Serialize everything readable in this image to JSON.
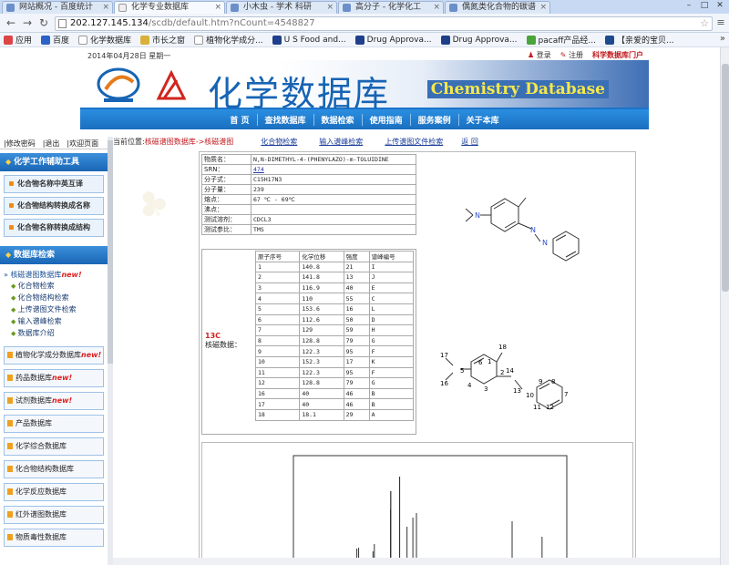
{
  "browser": {
    "tabs": [
      {
        "label": "网站概况 - 百度统计",
        "active": false
      },
      {
        "label": "化学专业数据库",
        "active": true
      },
      {
        "label": "小木虫 - 学术 科研",
        "active": false
      },
      {
        "label": "高分子 - 化学化工",
        "active": false
      },
      {
        "label": "偶氮类化合物的碳谱",
        "active": false
      }
    ],
    "url_host": "202.127.145.134",
    "url_path": "/scdb/default.htm?nCount=4548827",
    "bookmarks": [
      "应用",
      "百度",
      "化学数据库",
      "市长之窗",
      "植物化学成分...",
      "U S Food and...",
      "Drug Approva...",
      "Drug Approva...",
      "pacaff产品经...",
      "【亲爱的宝贝..."
    ],
    "bookmarks_more": "»"
  },
  "header": {
    "date": "2014年04月28日 星期一",
    "login": "登录",
    "register": "注册",
    "portal": "科学数据库门户",
    "title": "化学数据库",
    "title_en": "Chemistry Database",
    "nav": [
      "首 页",
      "查找数据库",
      "数据检索",
      "使用指南",
      "服务案例",
      "关于本库"
    ]
  },
  "sidebar": {
    "top_links": [
      "|修改密码",
      "|退出",
      "|欢迎页面"
    ],
    "tools_head": "化学工作辅助工具",
    "tools": [
      "化合物名称中英互译",
      "化合物结构转换成名称",
      "化合物名称转换成结构"
    ],
    "search_head": "数据库检索",
    "nmr_db": "核磁谱图数据库",
    "nmr_new": "new!",
    "nmr_items": [
      "化合物检索",
      "化合物结构检索",
      "上传谱图文件检索",
      "输入谱峰检索",
      "数据库介绍"
    ],
    "dbs": [
      {
        "label": "植物化学成分数据库",
        "new": "new!"
      },
      {
        "label": "药品数据库",
        "new": "new!"
      },
      {
        "label": "试剂数据库",
        "new": "new!"
      },
      {
        "label": "产品数据库",
        "new": ""
      },
      {
        "label": "化学综合数据库",
        "new": ""
      },
      {
        "label": "化合物结构数据库",
        "new": ""
      },
      {
        "label": "化学反应数据库",
        "new": ""
      },
      {
        "label": "红外谱图数据库",
        "new": ""
      },
      {
        "label": "物质毒性数据库",
        "new": ""
      }
    ]
  },
  "crumbs": {
    "current": "当前位置:",
    "path": "核磁谱图数据库->核磁谱图",
    "links": [
      "化合物检索",
      "输入谱峰检索",
      "上传谱图文件检索",
      "返 回"
    ]
  },
  "compound": {
    "props": [
      {
        "k": "物质名：",
        "v": "N,N-DIMETHYL-4-(PHENYLAZO)-m-TOLUIDINE"
      },
      {
        "k": "SRN：",
        "v": "474",
        "link": true
      },
      {
        "k": "分子式：",
        "v": "C15H17N3"
      },
      {
        "k": "分子量：",
        "v": "239"
      },
      {
        "k": "熔点：",
        "v": "67 ℃ - 69℃"
      },
      {
        "k": "沸点：",
        "v": ""
      },
      {
        "k": "测试溶剂：",
        "v": "CDCL3"
      },
      {
        "k": "测试参比：",
        "v": "TMS"
      }
    ],
    "nmr_label_red": "13C",
    "nmr_label": "核磁数据：",
    "peak_headers": [
      "原子序号",
      "化学位移",
      "强度",
      "谱峰编号"
    ],
    "peaks": [
      [
        "1",
        "140.8",
        "21",
        "I"
      ],
      [
        "2",
        "141.8",
        "13",
        "J"
      ],
      [
        "3",
        "116.9",
        "40",
        "E"
      ],
      [
        "4",
        "110",
        "55",
        "C"
      ],
      [
        "5",
        "153.6",
        "16",
        "L"
      ],
      [
        "6",
        "112.6",
        "50",
        "D"
      ],
      [
        "7",
        "129",
        "59",
        "H"
      ],
      [
        "8",
        "128.8",
        "79",
        "G"
      ],
      [
        "9",
        "122.3",
        "95",
        "F"
      ],
      [
        "10",
        "152.3",
        "17",
        "K"
      ],
      [
        "11",
        "122.3",
        "95",
        "F"
      ],
      [
        "12",
        "128.8",
        "79",
        "G"
      ],
      [
        "16",
        "40",
        "46",
        "B"
      ],
      [
        "17",
        "40",
        "46",
        "B"
      ],
      [
        "18",
        "18.1",
        "29",
        "A"
      ]
    ],
    "atom_labels": [
      "18",
      "17",
      "16",
      "5",
      "6",
      "4",
      "3",
      "1",
      "2",
      "14",
      "13",
      "10",
      "9",
      "8",
      "11",
      "12",
      "7"
    ]
  },
  "colors": {
    "accent": "#1a6fc0",
    "red": "#c0191e"
  }
}
